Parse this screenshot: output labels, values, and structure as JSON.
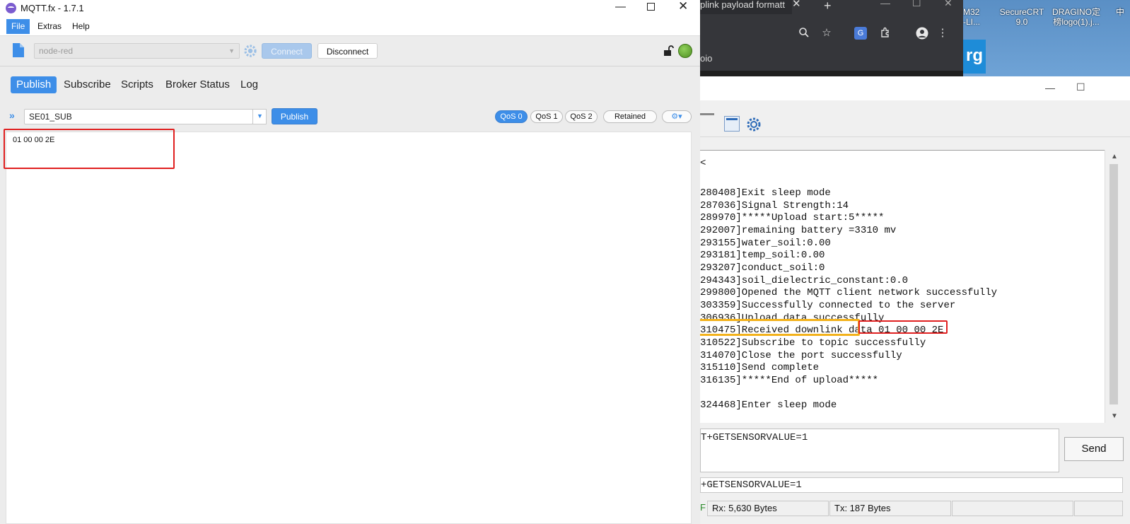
{
  "mqtt": {
    "window_title": "MQTT.fx - 1.7.1",
    "menu": [
      "File",
      "Extras",
      "Help"
    ],
    "profile": "node-red",
    "connect_label": "Connect",
    "disconnect_label": "Disconnect",
    "tabs": [
      "Publish",
      "Subscribe",
      "Scripts",
      "Broker Status",
      "Log"
    ],
    "topic": "SE01_SUB",
    "publish_label": "Publish",
    "qos": [
      "QoS 0",
      "QoS 1",
      "QoS 2"
    ],
    "retained_label": "Retained",
    "payload": "01 00 00 2E",
    "colors": {
      "accent": "#3d8ee8",
      "highlight_box": "#e02020",
      "status_dot": "#5aa02c"
    }
  },
  "chrome": {
    "tab_title": "plink payload formatt",
    "bookmark": "oio"
  },
  "desktop": {
    "icons": [
      {
        "label": "M32\n-LI..."
      },
      {
        "label": "SecureCRT\n9.0"
      },
      {
        "label": "DRAGINO定\n榜logo(1).j..."
      },
      {
        "label": "中"
      }
    ],
    "tile_text": "rg"
  },
  "serial": {
    "log_prefix_header": "<",
    "log_lines": [
      "280408]Exit sleep mode",
      "287036]Signal Strength:14",
      "289970]*****Upload start:5*****",
      "292007]remaining battery =3310 mv",
      "293155]water_soil:0.00",
      "293181]temp_soil:0.00",
      "293207]conduct_soil:0",
      "294343]soil_dielectric_constant:0.0",
      "299800]Opened the MQTT client network successfully",
      "303359]Successfully connected to the server",
      "306936]Upload data successfully",
      "310475]Received downlink data 01 00 00 2E",
      "310522]Subscribe to topic successfully",
      "314070]Close the port successfully",
      "315110]Send complete",
      "316135]*****End of upload*****",
      "",
      "324468]Enter sleep mode"
    ],
    "tx_text": "T+GETSENSORVALUE=1",
    "send_label": "Send",
    "cmd_text": "+GETSENSORVALUE=1",
    "status_f": "F",
    "rx_bytes": "Rx: 5,630 Bytes",
    "tx_bytes": "Tx: 187 Bytes",
    "colors": {
      "highlight_red": "#e02020",
      "highlight_yellow": "#f3b21b"
    }
  }
}
